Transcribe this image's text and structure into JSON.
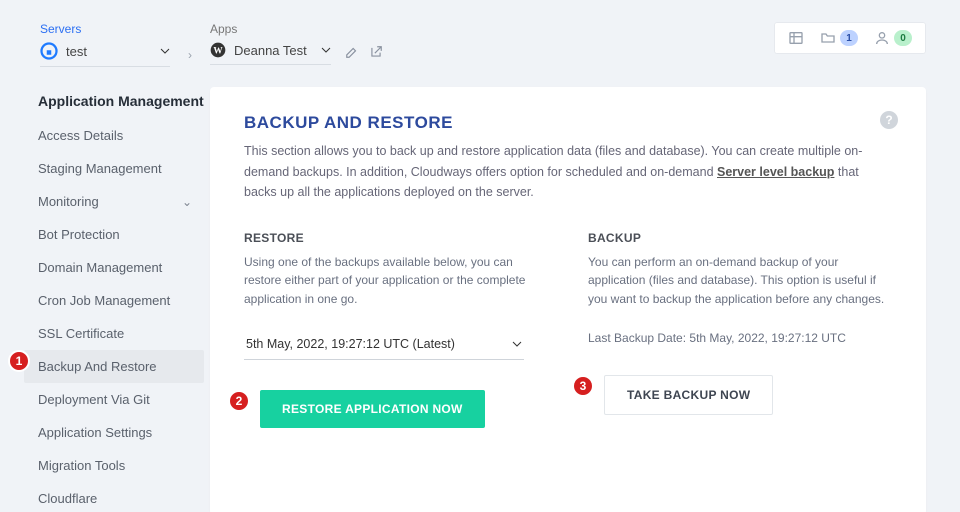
{
  "breadcrumb": {
    "servers_label": "Servers",
    "server_name": "test",
    "apps_label": "Apps",
    "app_name": "Deanna Test"
  },
  "topbar": {
    "notif_count": "1",
    "user_count": "0"
  },
  "sidebar": {
    "title": "Application Management",
    "items": [
      {
        "label": "Access Details"
      },
      {
        "label": "Staging Management"
      },
      {
        "label": "Monitoring",
        "expandable": true
      },
      {
        "label": "Bot Protection"
      },
      {
        "label": "Domain Management"
      },
      {
        "label": "Cron Job Management"
      },
      {
        "label": "SSL Certificate"
      },
      {
        "label": "Backup And Restore",
        "selected": true
      },
      {
        "label": "Deployment Via Git"
      },
      {
        "label": "Application Settings"
      },
      {
        "label": "Migration Tools"
      },
      {
        "label": "Cloudflare"
      }
    ]
  },
  "panel": {
    "title": "BACKUP AND RESTORE",
    "desc_pre": "This section allows you to back up and restore application data (files and database). You can create multiple on-demand backups. In addition, Cloudways offers option for scheduled and on-demand ",
    "desc_link": "Server level backup",
    "desc_post": " that backs up all the applications deployed on the server."
  },
  "restore": {
    "title": "RESTORE",
    "desc": "Using one of the backups available below, you can restore either part of your application or the complete application in one go.",
    "selected": "5th May, 2022, 19:27:12 UTC (Latest)",
    "button": "RESTORE APPLICATION NOW"
  },
  "backup": {
    "title": "BACKUP",
    "desc": "You can perform an on-demand backup of your application (files and database). This option is useful if you want to backup the application before any changes.",
    "last_label": "Last Backup Date: ",
    "last_value": "5th May, 2022, 19:27:12 UTC",
    "button": "TAKE BACKUP NOW"
  },
  "callouts": {
    "one": "1",
    "two": "2",
    "three": "3"
  }
}
